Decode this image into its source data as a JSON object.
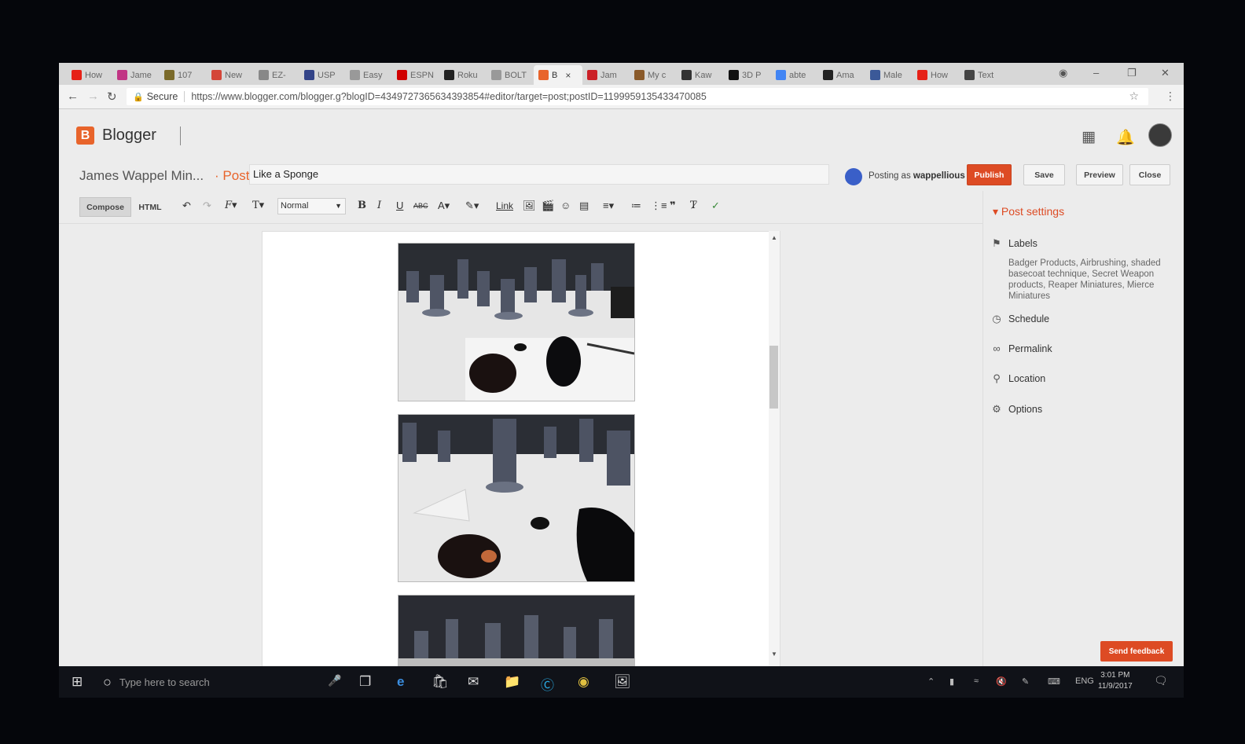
{
  "tabs": [
    {
      "label": "How",
      "icon": "youtube-icon",
      "color": "#e62117"
    },
    {
      "label": "Jame",
      "icon": "instagram-icon",
      "color": "#c13584"
    },
    {
      "label": "107",
      "icon": "image-icon",
      "color": "#7a6a2a"
    },
    {
      "label": "New",
      "icon": "gmail-icon",
      "color": "#d44638"
    },
    {
      "label": "EZ-",
      "icon": "page-icon",
      "color": "#888888"
    },
    {
      "label": "USP",
      "icon": "usps-icon",
      "color": "#334488"
    },
    {
      "label": "Easy",
      "icon": "document-icon",
      "color": "#999999"
    },
    {
      "label": "ESPN",
      "icon": "espn-icon",
      "color": "#d00000"
    },
    {
      "label": "Roku",
      "icon": "roku-icon",
      "color": "#222222"
    },
    {
      "label": "BOLT",
      "icon": "document-icon",
      "color": "#999999"
    },
    {
      "label": "B",
      "icon": "blogger-icon",
      "color": "#e8642b",
      "active": true
    },
    {
      "label": "Jam",
      "icon": "pinterest-icon",
      "color": "#cb2027"
    },
    {
      "label": "My c",
      "icon": "bag-icon",
      "color": "#8a5a2a"
    },
    {
      "label": "Kaw",
      "icon": "shield-icon",
      "color": "#333333"
    },
    {
      "label": "3D P",
      "icon": "k-icon",
      "color": "#111111"
    },
    {
      "label": "abte",
      "icon": "google-icon",
      "color": "#4285f4"
    },
    {
      "label": "Ama",
      "icon": "amazon-icon",
      "color": "#222222"
    },
    {
      "label": "Male",
      "icon": "facebook-icon",
      "color": "#3b5998"
    },
    {
      "label": "How",
      "icon": "youtube-icon",
      "color": "#e62117"
    },
    {
      "label": "Text",
      "icon": "gear-icon",
      "color": "#444444"
    }
  ],
  "address": {
    "secure_label": "Secure",
    "url": "https://www.blogger.com/blogger.g?blogID=4349727365634393854#editor/target=post;postID=1199959135433470085"
  },
  "header": {
    "app_name": "Blogger",
    "logo_letter": "B"
  },
  "post": {
    "blog_title": "James Wappel Min...",
    "post_word": "Post",
    "post_separator": "·",
    "title": "Like a Sponge",
    "posting_as_prefix": "Posting as",
    "username": "wappellious"
  },
  "actions": {
    "publish": "Publish",
    "save": "Save",
    "preview": "Preview",
    "close": "Close"
  },
  "format": {
    "compose": "Compose",
    "html": "HTML",
    "style": "Normal",
    "link": "Link"
  },
  "sidebar": {
    "heading": "Post settings",
    "labels_title": "Labels",
    "labels_value": "Badger Products, Airbrushing, shaded basecoat technique, Secret Weapon products, Reaper Miniatures, Mierce Miniatures",
    "schedule": "Schedule",
    "permalink": "Permalink",
    "location": "Location",
    "options": "Options",
    "feedback": "Send feedback"
  },
  "taskbar": {
    "search_placeholder": "Type here to search",
    "lang": "ENG",
    "time": "3:01 PM",
    "date": "11/9/2017"
  },
  "colors": {
    "accent": "#dd4b24",
    "blogger": "#e8642b"
  }
}
